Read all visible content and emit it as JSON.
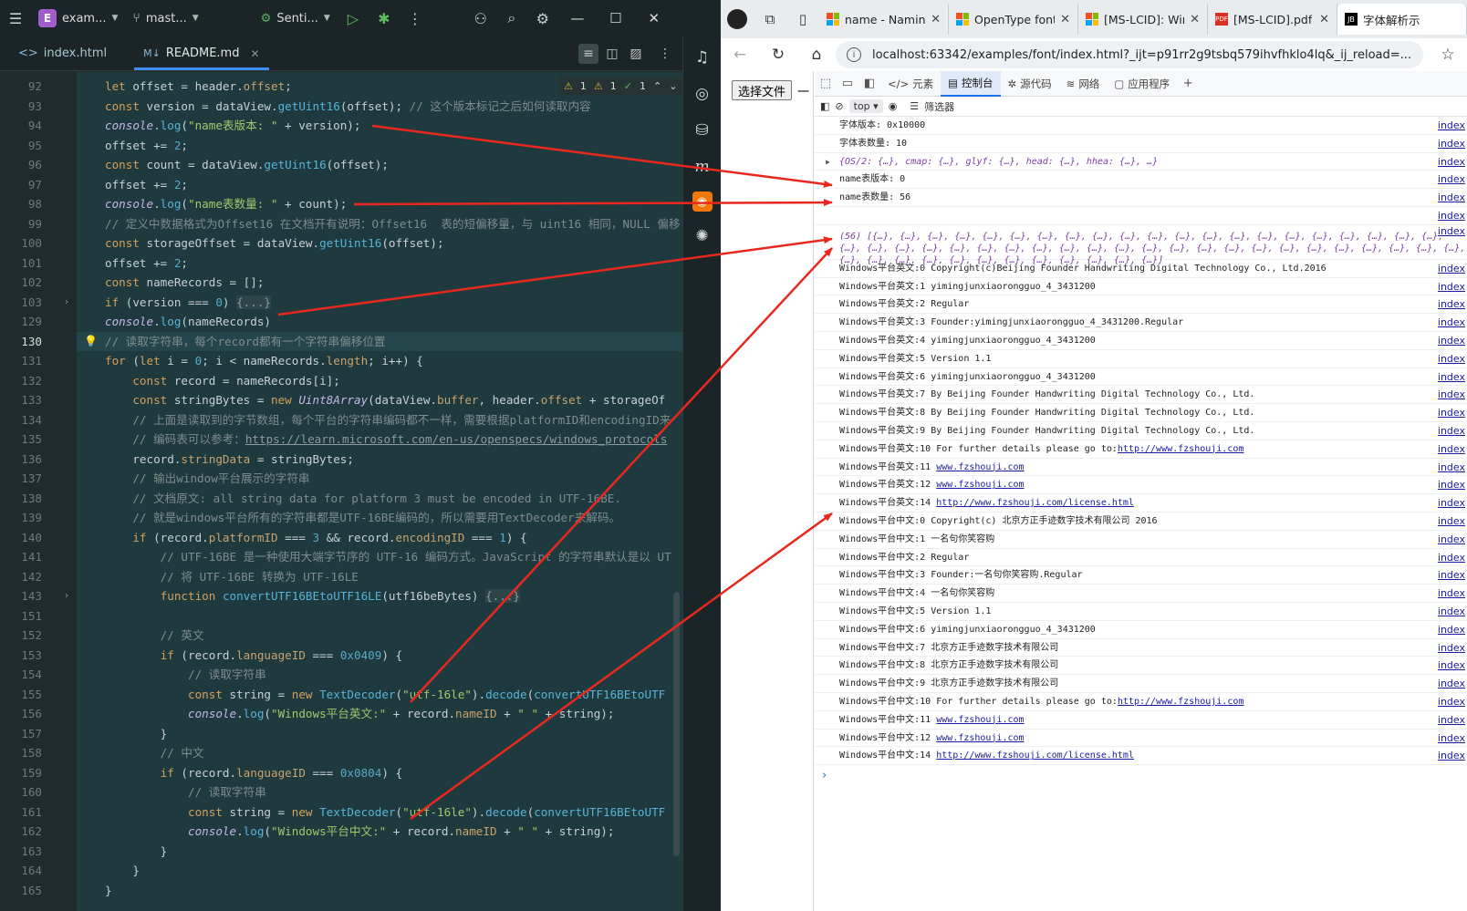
{
  "ide": {
    "project_badge": "E",
    "project_name": "exam...",
    "branch": "mast...",
    "run_config": "Senti...",
    "tabs": [
      {
        "label": "index.html",
        "icon": "<>"
      },
      {
        "label": "README.md",
        "icon": "M↓"
      }
    ],
    "inspection": {
      "warn1": "1",
      "warn2": "1",
      "ok": "1"
    },
    "current_line": 130,
    "code": [
      {
        "ln": "92",
        "html": "<span class='k'>let</span> offset = header.<span class='p'>offset</span>;"
      },
      {
        "ln": "93",
        "html": "<span class='k'>const</span> version = dataView.<span class='f'>getUint16</span>(offset); <span class='c'>// 这个版本标记之后如何读取内容</span>"
      },
      {
        "ln": "94",
        "html": "<span class='it'>console</span>.<span class='f'>log</span>(<span class='s'>\"name表版本: \"</span> + version);"
      },
      {
        "ln": "95",
        "html": "offset += <span class='n'>2</span>;"
      },
      {
        "ln": "96",
        "html": "<span class='k'>const</span> count = dataView.<span class='f'>getUint16</span>(offset);"
      },
      {
        "ln": "97",
        "html": "offset += <span class='n'>2</span>;"
      },
      {
        "ln": "98",
        "html": "<span class='it'>console</span>.<span class='f'>log</span>(<span class='s'>\"name表数量: \"</span> + count);"
      },
      {
        "ln": "99",
        "html": "<span class='c'>// 定义中数据格式为Offset16 在文档开有说明：Offset16  表的短偏移量，与 uint16 相同，NULL 偏移</span>"
      },
      {
        "ln": "100",
        "html": "<span class='k'>const</span> storageOffset = dataView.<span class='f'>getUint16</span>(offset);"
      },
      {
        "ln": "101",
        "html": "offset += <span class='n'>2</span>;"
      },
      {
        "ln": "102",
        "html": "<span class='k'>const</span> nameRecords = [];"
      },
      {
        "ln": "103",
        "html": "<span class='k'>if</span> (version === <span class='n'>0</span>) <span class='fold-txt'>{...}</span>",
        "fold": true
      },
      {
        "ln": "129",
        "html": "<span class='it'>console</span>.<span class='f'>log</span>(nameRecords)"
      },
      {
        "ln": "130",
        "html": "<span class='c'>// 读取字符串，每个record都有一个字符串偏移位置</span>",
        "bulb": true
      },
      {
        "ln": "131",
        "html": "<span class='k'>for</span> (<span class='k'>let</span> i = <span class='n'>0</span>; i &lt; nameRecords.<span class='p'>length</span>; i++) {"
      },
      {
        "ln": "132",
        "html": "    <span class='k'>const</span> record = nameRecords[i];"
      },
      {
        "ln": "133",
        "html": "    <span class='k'>const</span> stringBytes = <span class='k'>new</span> <span class='it'>Uint8Array</span>(dataView.<span class='p'>buffer</span>, header.<span class='p'>offset</span> + storageOf"
      },
      {
        "ln": "134",
        "html": "    <span class='c'>// 上面是读取到的字节数组，每个平台的字符串编码都不一样，需要根据platformID和encodingID来</span>"
      },
      {
        "ln": "135",
        "html": "    <span class='c'>// 编码表可以参考：<span class='url'>https://learn.microsoft.com/en-us/openspecs/windows_protocols</span></span>"
      },
      {
        "ln": "136",
        "html": "    record.<span class='p'>stringData</span> = stringBytes;"
      },
      {
        "ln": "137",
        "html": "    <span class='c'>// 输出window平台展示的字符串</span>"
      },
      {
        "ln": "138",
        "html": "    <span class='c'>// 文档原文: all string data for platform 3 must be encoded in UTF-16BE.</span>"
      },
      {
        "ln": "139",
        "html": "    <span class='c'>// 就是windows平台所有的字符串都是UTF-16BE编码的，所以需要用TextDecoder来解码。</span>"
      },
      {
        "ln": "140",
        "html": "    <span class='k'>if</span> (record.<span class='p'>platformID</span> === <span class='n'>3</span> &amp;&amp; record.<span class='p'>encodingID</span> === <span class='n'>1</span>) {"
      },
      {
        "ln": "141",
        "html": "        <span class='c'>// UTF-16BE 是一种使用大端字节序的 UTF-16 编码方式。JavaScript 的字符串默认是以 UT</span>"
      },
      {
        "ln": "142",
        "html": "        <span class='c'>// 将 UTF-16BE 转换为 UTF-16LE</span>"
      },
      {
        "ln": "143",
        "html": "        <span class='k'>function</span> <span class='f'>convertUTF16BEtoUTF16LE</span>(utf16beBytes) <span class='fold-txt'>{...}</span>",
        "fold": true
      },
      {
        "ln": "151",
        "html": ""
      },
      {
        "ln": "152",
        "html": "        <span class='c'>// 英文</span>"
      },
      {
        "ln": "153",
        "html": "        <span class='k'>if</span> (record.<span class='p'>languageID</span> === <span class='n'>0x0409</span>) {"
      },
      {
        "ln": "154",
        "html": "            <span class='c'>// 读取字符串</span>"
      },
      {
        "ln": "155",
        "html": "            <span class='k'>const</span> string = <span class='k'>new</span> <span class='f'>TextDecoder</span>(<span class='s'>\"utf-16le\"</span>).<span class='f'>decode</span>(<span class='f'>convertUTF16BEtoUTF</span>"
      },
      {
        "ln": "156",
        "html": "            <span class='it'>console</span>.<span class='f'>log</span>(<span class='s'>\"Windows平台英文:\"</span> + record.<span class='p'>nameID</span> + <span class='s'>\" \"</span> + string);"
      },
      {
        "ln": "157",
        "html": "        }"
      },
      {
        "ln": "158",
        "html": "        <span class='c'>// 中文</span>"
      },
      {
        "ln": "159",
        "html": "        <span class='k'>if</span> (record.<span class='p'>languageID</span> === <span class='n'>0x0804</span>) {"
      },
      {
        "ln": "160",
        "html": "            <span class='c'>// 读取字符串</span>"
      },
      {
        "ln": "161",
        "html": "            <span class='k'>const</span> string = <span class='k'>new</span> <span class='f'>TextDecoder</span>(<span class='s'>\"utf-16le\"</span>).<span class='f'>decode</span>(<span class='f'>convertUTF16BEtoUTF</span>"
      },
      {
        "ln": "162",
        "html": "            <span class='it'>console</span>.<span class='f'>log</span>(<span class='s'>\"Windows平台中文:\"</span> + record.<span class='p'>nameID</span> + <span class='s'>\" \"</span> + string);"
      },
      {
        "ln": "163",
        "html": "        }"
      },
      {
        "ln": "164",
        "html": "    }"
      },
      {
        "ln": "165",
        "html": "}"
      }
    ]
  },
  "browser": {
    "tabs": [
      {
        "icon": "ms",
        "title": "name - Naming"
      },
      {
        "icon": "ms",
        "title": "OpenType font"
      },
      {
        "icon": "ms",
        "title": "[MS-LCID]: Wind"
      },
      {
        "icon": "pdf",
        "title": "[MS-LCID].pdf"
      },
      {
        "icon": "jb",
        "title": "字体解析示"
      }
    ],
    "url": "localhost:63342/examples/font/index.html?_ijt=p91rr2g9tsbq579ihvfhklo4lq&_ij_reload=...",
    "file_button": "选择文件",
    "file_label": "一",
    "devtools_tabs": [
      {
        "icon": "</>",
        "label": "元素"
      },
      {
        "icon": "▤",
        "label": "控制台",
        "active": true
      },
      {
        "icon": "✲",
        "label": "源代码"
      },
      {
        "icon": "≋",
        "label": "网络"
      },
      {
        "icon": "▢",
        "label": "应用程序"
      }
    ],
    "context": "top",
    "filter_label": "筛选器",
    "source_link": "index",
    "console": [
      {
        "text": "字体版本: 0x10000"
      },
      {
        "text": "字体表数量: 10"
      },
      {
        "text": "{OS/2: {…}, cmap: {…}, glyf: {…}, head: {…}, hhea: {…}, …}",
        "kind": "obj"
      },
      {
        "text": "name表版本: 0"
      },
      {
        "text": "name表数量: 56"
      },
      {
        "text": "",
        "kind": "blank"
      },
      {
        "text": "(56) [{…}, {…}, {…}, {…}, {…}, {…}, {…}, {…}, {…}, {…}, {…}, {…}, {…}, {…}, {…}, {…}, {…}, {…}, {…}, {…}, {…}, {…}, {…}, {…}, {…}, {…}, {…}, {…}, {…}, {…}, {…}, {…}, {…}, {…}, {…}, {…}, {…}, {…}, {…}, {…}, {…}, {…}, {…}, {…}, {…}, {…}, {…}, {…}, {…}, {…}, {…}, {…}, {…}, {…}, {…}, {…}]",
        "kind": "array"
      },
      {
        "text": "Windows平台英文:0 Copyright(c)Beijing Founder Handwriting Digital Technology Co., Ltd.2016"
      },
      {
        "text": "Windows平台英文:1 yimingjunxiaorongguo_4_3431200"
      },
      {
        "text": "Windows平台英文:2 Regular"
      },
      {
        "text": "Windows平台英文:3 Founder:yimingjunxiaorongguo_4_3431200.Regular"
      },
      {
        "text": "Windows平台英文:4 yimingjunxiaorongguo_4_3431200"
      },
      {
        "text": "Windows平台英文:5 Version 1.1"
      },
      {
        "text": "Windows平台英文:6 yimingjunxiaorongguo_4_3431200"
      },
      {
        "text": "Windows平台英文:7 By Beijing Founder Handwriting Digital Technology Co., Ltd."
      },
      {
        "text": "Windows平台英文:8 By Beijing Founder Handwriting Digital Technology Co., Ltd."
      },
      {
        "text": "Windows平台英文:9 By Beijing Founder Handwriting Digital Technology Co., Ltd."
      },
      {
        "text": "Windows平台英文:10 For further details please go to:",
        "link": "http://www.fzshouji.com"
      },
      {
        "text": "Windows平台英文:11 ",
        "link": "www.fzshouji.com"
      },
      {
        "text": "Windows平台英文:12 ",
        "link": "www.fzshouji.com"
      },
      {
        "text": "Windows平台英文:14 ",
        "link": "http://www.fzshouji.com/license.html"
      },
      {
        "text": "Windows平台中文:0 Copyright(c) 北京方正手迹数字技术有限公司 2016"
      },
      {
        "text": "Windows平台中文:1 一名句你笑容购"
      },
      {
        "text": "Windows平台中文:2 Regular"
      },
      {
        "text": "Windows平台中文:3 Founder:一名句你笑容购.Regular"
      },
      {
        "text": "Windows平台中文:4 一名句你笑容购"
      },
      {
        "text": "Windows平台中文:5 Version 1.1"
      },
      {
        "text": "Windows平台中文:6 yimingjunxiaorongguo_4_3431200"
      },
      {
        "text": "Windows平台中文:7 北京方正手迹数字技术有限公司"
      },
      {
        "text": "Windows平台中文:8 北京方正手迹数字技术有限公司"
      },
      {
        "text": "Windows平台中文:9 北京方正手迹数字技术有限公司"
      },
      {
        "text": "Windows平台中文:10 For further details please go to:",
        "link": "http://www.fzshouji.com"
      },
      {
        "text": "Windows平台中文:11 ",
        "link": "www.fzshouji.com"
      },
      {
        "text": "Windows平台中文:12 ",
        "link": "www.fzshouji.com"
      },
      {
        "text": "Windows平台中文:14 ",
        "link": "http://www.fzshouji.com/license.html"
      }
    ]
  },
  "colors": {
    "annotation_arrow": "#e8281e",
    "ide_bg": "#1e3a3e",
    "accent": "#3d8df5"
  }
}
